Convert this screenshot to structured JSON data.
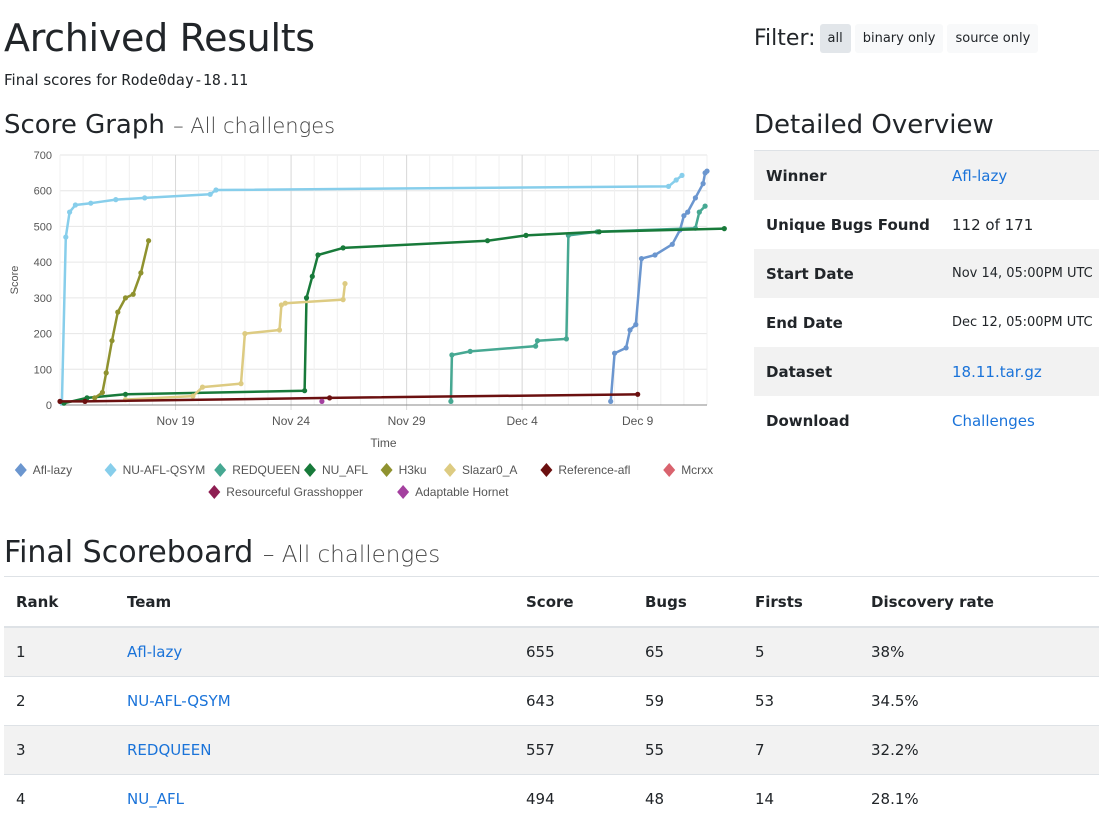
{
  "header": {
    "title": "Archived Results",
    "subtitle_prefix": "Final scores for ",
    "subtitle_event": "Rode0day-18.11"
  },
  "filter": {
    "label": "Filter:",
    "options": [
      "all",
      "binary only",
      "source only"
    ],
    "selected": "all"
  },
  "score_graph": {
    "heading": "Score Graph",
    "heading_suffix": "– All challenges"
  },
  "chart_data": {
    "type": "line",
    "xlabel": "Time",
    "ylabel": "Score",
    "ylim": [
      0,
      700
    ],
    "yticks": [
      0,
      100,
      200,
      300,
      400,
      500,
      600,
      700
    ],
    "xlim": [
      "2018-11-14",
      "2018-12-12"
    ],
    "xticks": [
      "Nov 19",
      "Nov 24",
      "Nov 29",
      "Dec 4",
      "Dec 9"
    ],
    "grid": true,
    "legend_position": "bottom",
    "series": [
      {
        "name": "Afl-lazy",
        "color": "#6b96cf",
        "x": [
          "2018-12-07T20:00",
          "2018-12-08T00:00",
          "2018-12-08T12:00",
          "2018-12-08T16:00",
          "2018-12-08T22:00",
          "2018-12-09T04:00",
          "2018-12-09T18:00",
          "2018-12-10T12:00",
          "2018-12-10T20:00",
          "2018-12-11T00:00",
          "2018-12-11T04:00",
          "2018-12-11T12:00",
          "2018-12-11T20:00",
          "2018-12-11T22:00",
          "2018-12-12T00:00"
        ],
        "y": [
          10,
          145,
          160,
          210,
          225,
          410,
          420,
          450,
          490,
          530,
          540,
          580,
          620,
          650,
          655
        ]
      },
      {
        "name": "NU-AFL-QSYM",
        "color": "#87ceeb",
        "x": [
          "2018-11-14T02:00",
          "2018-11-14T06:00",
          "2018-11-14T10:00",
          "2018-11-14T16:00",
          "2018-11-15T08:00",
          "2018-11-16T10:00",
          "2018-11-17T16:00",
          "2018-11-20T12:00",
          "2018-11-20T18:00",
          "2018-12-10T08:00",
          "2018-12-10T16:00",
          "2018-12-10T22:00"
        ],
        "y": [
          5,
          470,
          540,
          560,
          565,
          575,
          580,
          590,
          602,
          612,
          630,
          643
        ]
      },
      {
        "name": "REDQUEEN",
        "color": "#46a892",
        "x": [
          "2018-11-30T22:00",
          "2018-11-30T23:00",
          "2018-12-01T18:00",
          "2018-12-04T14:00",
          "2018-12-04T16:00",
          "2018-12-05T22:00",
          "2018-12-06T00:00",
          "2018-12-07T06:00",
          "2018-12-11T12:00",
          "2018-12-11T16:00",
          "2018-12-11T22:00"
        ],
        "y": [
          10,
          140,
          150,
          165,
          180,
          185,
          475,
          485,
          495,
          540,
          557
        ]
      },
      {
        "name": "NU_AFL",
        "color": "#187a3a",
        "x": [
          "2018-11-14T04:00",
          "2018-11-15T04:00",
          "2018-11-16T20:00",
          "2018-11-24T14:00",
          "2018-11-24T16:00",
          "2018-11-24T22:00",
          "2018-11-25T04:00",
          "2018-11-26T06:00",
          "2018-12-02T12:00",
          "2018-12-04T04:00",
          "2018-12-07T08:00",
          "2018-12-12T18:00"
        ],
        "y": [
          5,
          20,
          30,
          40,
          300,
          360,
          420,
          440,
          460,
          475,
          485,
          494
        ]
      },
      {
        "name": "H3ku",
        "color": "#8f922f",
        "x": [
          "2018-11-15T12:00",
          "2018-11-15T20:00",
          "2018-11-16T00:00",
          "2018-11-16T06:00",
          "2018-11-16T12:00",
          "2018-11-16T20:00",
          "2018-11-17T04:00",
          "2018-11-17T12:00",
          "2018-11-17T20:00"
        ],
        "y": [
          20,
          35,
          90,
          180,
          260,
          300,
          310,
          370,
          460
        ]
      },
      {
        "name": "Slazar0_A",
        "color": "#ddcb82",
        "x": [
          "2018-11-16T20:00",
          "2018-11-19T18:00",
          "2018-11-20T04:00",
          "2018-11-21T20:00",
          "2018-11-22T00:00",
          "2018-11-23T12:00",
          "2018-11-23T14:00",
          "2018-11-23T18:00",
          "2018-11-26T06:00",
          "2018-11-26T08:00"
        ],
        "y": [
          15,
          25,
          50,
          60,
          200,
          210,
          280,
          285,
          295,
          340
        ]
      },
      {
        "name": "Reference-afl",
        "color": "#6b1010",
        "x": [
          "2018-11-14T00:00",
          "2018-11-15T02:00",
          "2018-11-25T16:00",
          "2018-12-09T00:00"
        ],
        "y": [
          10,
          10,
          20,
          30
        ]
      },
      {
        "name": "Mcrxx",
        "color": "#d9636e",
        "x": [],
        "y": []
      },
      {
        "name": "Resourceful Grasshopper",
        "color": "#8e1e52",
        "x": [],
        "y": []
      },
      {
        "name": "Adaptable Hornet",
        "color": "#a4409f",
        "x": [
          "2018-11-25T08:00"
        ],
        "y": [
          10
        ]
      }
    ]
  },
  "overview": {
    "heading": "Detailed Overview",
    "rows": [
      {
        "key": "Winner",
        "value": "Afl-lazy",
        "link": true
      },
      {
        "key": "Unique Bugs Found",
        "value": "112 of 171",
        "link": false
      },
      {
        "key": "Start Date",
        "value": "Nov 14, 05:00PM UTC",
        "link": false
      },
      {
        "key": "End Date",
        "value": "Dec 12, 05:00PM UTC",
        "link": false
      },
      {
        "key": "Dataset",
        "value": "18.11.tar.gz",
        "link": true
      },
      {
        "key": "Download",
        "value": "Challenges",
        "link": true
      }
    ]
  },
  "scoreboard": {
    "heading": "Final Scoreboard",
    "heading_suffix": "– All challenges",
    "columns": [
      "Rank",
      "Team",
      "Score",
      "Bugs",
      "Firsts",
      "Discovery rate"
    ],
    "rows": [
      [
        "1",
        "Afl-lazy",
        "655",
        "65",
        "5",
        "38%"
      ],
      [
        "2",
        "NU-AFL-QSYM",
        "643",
        "59",
        "53",
        "34.5%"
      ],
      [
        "3",
        "REDQUEEN",
        "557",
        "55",
        "7",
        "32.2%"
      ],
      [
        "4",
        "NU_AFL",
        "494",
        "48",
        "14",
        "28.1%"
      ]
    ]
  }
}
